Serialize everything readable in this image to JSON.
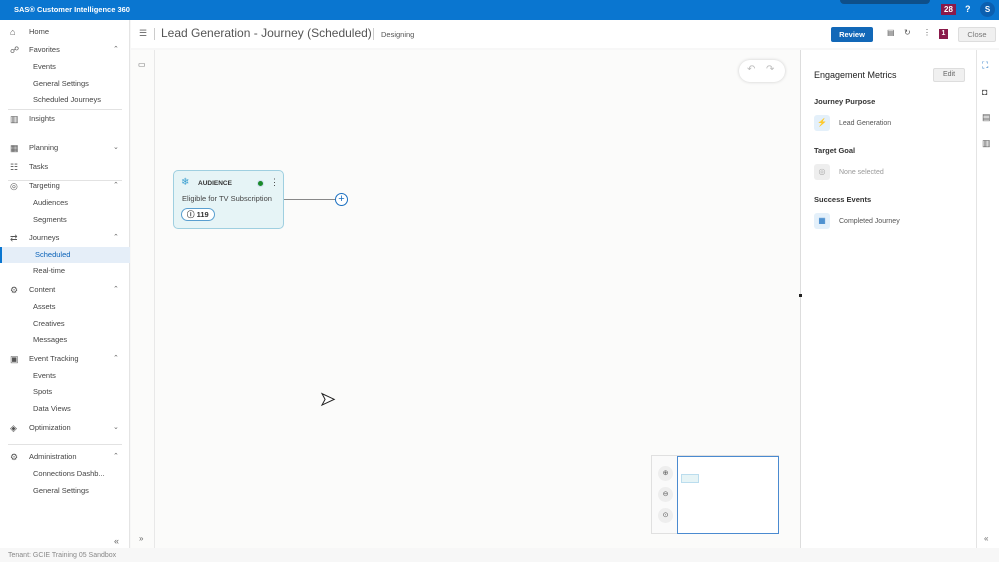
{
  "app": {
    "title": "SAS® Customer Intelligence 360",
    "notifications": "28",
    "help": "?",
    "user_initial": "S"
  },
  "sidebar": {
    "items": [
      {
        "label": "Home",
        "icon": "home-icon",
        "type": "top"
      },
      {
        "label": "Favorites",
        "icon": "favorites-icon",
        "type": "top",
        "expanded": true
      },
      {
        "label": "Events",
        "type": "sub"
      },
      {
        "label": "General Settings",
        "type": "sub"
      },
      {
        "label": "Scheduled Journeys",
        "type": "sub"
      },
      {
        "label": "Insights",
        "icon": "insights-icon",
        "type": "top"
      },
      {
        "label": "Planning",
        "icon": "planning-icon",
        "type": "top",
        "expanded": false
      },
      {
        "label": "Tasks",
        "icon": "tasks-icon",
        "type": "top"
      },
      {
        "label": "Targeting",
        "icon": "targeting-icon",
        "type": "top",
        "expanded": true
      },
      {
        "label": "Audiences",
        "type": "sub"
      },
      {
        "label": "Segments",
        "type": "sub"
      },
      {
        "label": "Journeys",
        "icon": "journeys-icon",
        "type": "top",
        "expanded": true
      },
      {
        "label": "Scheduled",
        "type": "sub",
        "active": true
      },
      {
        "label": "Real-time",
        "type": "sub"
      },
      {
        "label": "Content",
        "icon": "content-icon",
        "type": "top",
        "expanded": true
      },
      {
        "label": "Assets",
        "type": "sub"
      },
      {
        "label": "Creatives",
        "type": "sub"
      },
      {
        "label": "Messages",
        "type": "sub"
      },
      {
        "label": "Event Tracking",
        "icon": "event-tracking-icon",
        "type": "top",
        "expanded": true
      },
      {
        "label": "Events",
        "type": "sub"
      },
      {
        "label": "Spots",
        "type": "sub"
      },
      {
        "label": "Data Views",
        "type": "sub"
      },
      {
        "label": "Optimization",
        "icon": "optimization-icon",
        "type": "top",
        "expanded": false
      },
      {
        "label": "Administration",
        "icon": "administration-icon",
        "type": "top",
        "expanded": true
      },
      {
        "label": "Connections Dashb...",
        "type": "sub"
      },
      {
        "label": "General Settings",
        "type": "sub"
      }
    ],
    "collapse": "«"
  },
  "footer": {
    "tenant": "Tenant: GCIE Training 05 Sandbox"
  },
  "header": {
    "title": "Lead Generation - Journey (Scheduled)",
    "status": "Designing",
    "review": "Review",
    "badge": "1",
    "close": "Close"
  },
  "canvas": {
    "node": {
      "type": "AUDIENCE",
      "name": "Eligible for TV Subscription",
      "count": "119",
      "status_color": "#1a8a2a"
    }
  },
  "panel": {
    "title": "Engagement Metrics",
    "edit": "Edit",
    "purpose": {
      "heading": "Journey Purpose",
      "value": "Lead Generation"
    },
    "goal": {
      "heading": "Target Goal",
      "value": "None selected"
    },
    "success": {
      "heading": "Success Events",
      "value": "Completed Journey"
    }
  },
  "colors": {
    "brand": "#0a76d0",
    "accent": "#8a1a4a"
  }
}
